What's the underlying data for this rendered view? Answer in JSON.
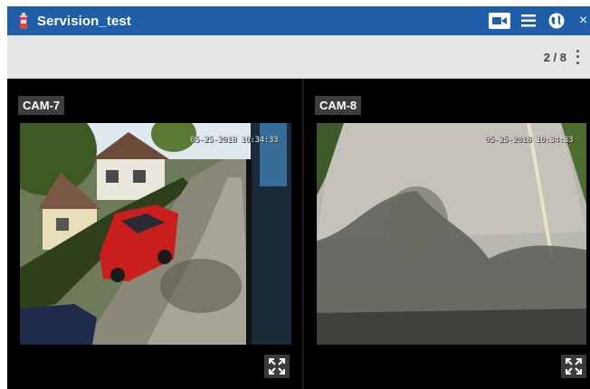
{
  "window": {
    "title": "Servision_test",
    "brand_color": "#1f5ea8",
    "app_icon": "fire-extinguisher-icon"
  },
  "titlebar_actions": [
    {
      "icon": "video-camera-icon"
    },
    {
      "icon": "hamburger-menu-icon"
    },
    {
      "icon": "globe-icon"
    },
    {
      "icon": "close-icon",
      "glyph": "×"
    }
  ],
  "toolbar": {
    "page_indicator": "2 / 8",
    "more_icon": "kebab-menu-icon"
  },
  "cameras": [
    {
      "label": "CAM-7",
      "timestamp": "05-25-2018 10:34:33",
      "fullscreen_icon": "expand-icon"
    },
    {
      "label": "CAM-8",
      "timestamp": "05-25-2018 10:34:33",
      "fullscreen_icon": "expand-icon"
    }
  ]
}
